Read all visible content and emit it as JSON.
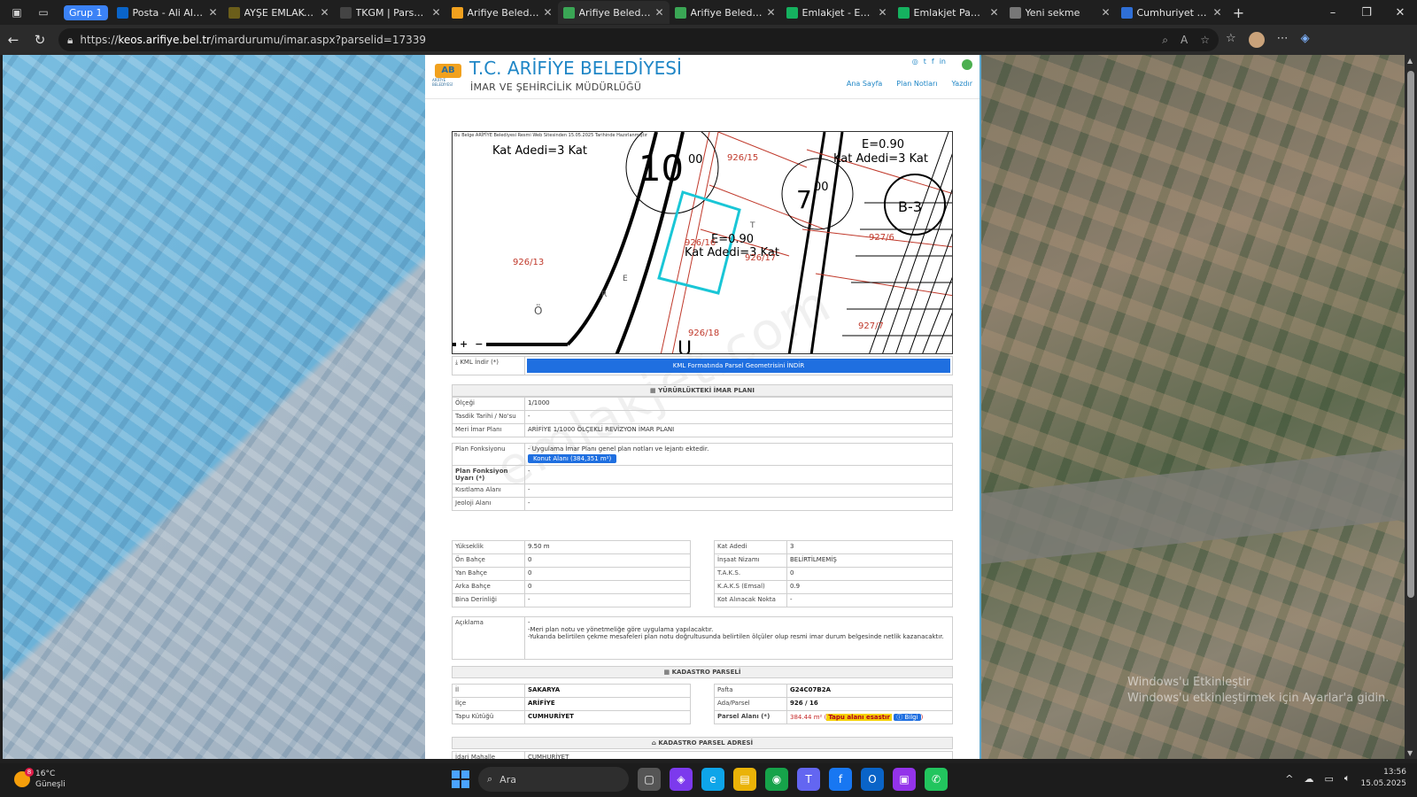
{
  "browser": {
    "group_label": "Grup 1",
    "tabs": [
      {
        "title": "Posta - Ali Altun -",
        "icon": "outlook-icon",
        "color": "#0a64c8"
      },
      {
        "title": "AYŞE EMLAKTAN",
        "icon": "s-icon",
        "color": "#6b5e1a"
      },
      {
        "title": "TKGM | Parsel Sor",
        "icon": "pin-icon",
        "color": "#444444"
      },
      {
        "title": "Arifiye Belediyesi",
        "icon": "arifiye-icon",
        "color": "#f1a11e"
      },
      {
        "title": "Arifiye Belediyesi",
        "icon": "compass-icon",
        "color": "#3aa655",
        "active": true
      },
      {
        "title": "Arifiye Belediyesi",
        "icon": "compass-icon",
        "color": "#3aa655"
      },
      {
        "title": "Emlakjet - Ev ve D",
        "icon": "emlakjet-icon",
        "color": "#15b15f"
      },
      {
        "title": "Emlakjet Panel",
        "icon": "emlakjet-icon",
        "color": "#15b15f"
      },
      {
        "title": "Yeni sekme",
        "icon": "page-icon",
        "color": "#777777"
      },
      {
        "title": "Cumhuriyet Mah",
        "icon": "globe-icon",
        "color": "#2f6fd6"
      }
    ],
    "url_prefix": "https://",
    "url_host": "keos.arifiye.bel.tr",
    "url_path": "/imardurumu/imar.aspx?parselid=17339"
  },
  "header": {
    "title": "T.C. ARİFİYE BELEDİYESİ",
    "subtitle": "İMAR VE ŞEHİRCİLİK MÜDÜRLÜĞÜ",
    "logo_text": "AB",
    "logo_small": "ARİFİYE BELEDİYESİ",
    "nav": [
      "Ana Sayfa",
      "Plan Notları",
      "Yazdır"
    ]
  },
  "map": {
    "notice": "Bu Belge ARİFİYE Belediyesi Resmi Web Sitesinden 15.05.2025 Tarihinde Hazırlanmıştır",
    "labels": {
      "kat_top_left": "Kat Adedi=3 Kat",
      "e_top_right": "E=0.90",
      "kat_top_right": "Kat Adedi=3 Kat",
      "e_center": "E=0.90",
      "kat_center": "Kat Adedi=3 Kat",
      "p1": "926/15",
      "p2": "926/16",
      "p3": "926/17",
      "p4": "926/13",
      "p5": "926/18",
      "p6": "927/6",
      "p7": "927/7",
      "circle1": "10",
      "circle1_sub": "00",
      "circle2": "7",
      "circle2_sub": "00",
      "b3": "B-3",
      "road_o": "Ö",
      "road_r": "R",
      "road_t": "T",
      "road_e": "E",
      "u_label": "U"
    },
    "zoom_in": "+",
    "zoom_out": "−"
  },
  "watermark": "emlakjet.com",
  "kml": {
    "label": "KML İndir (*)",
    "button": "KML Formatında Parsel Geometrisini İNDİR"
  },
  "imar_plani": {
    "section_title": "YÜRÜRLÜKTEKİ İMAR PLANI",
    "rows": [
      {
        "label": "Ölçeği",
        "value": "1/1000"
      },
      {
        "label": "Tasdik Tarihi / No'su",
        "value": "-"
      },
      {
        "label": "Meri İmar Planı",
        "value": "ARİFİYE 1/1000 ÖLÇEKLİ REVİZYON İMAR PLANI"
      }
    ],
    "fonksiyon_label": "Plan Fonksiyonu",
    "fonksiyon_text": "- Uygulama İmar Planı genel plan notları ve lejantı ektedir.",
    "fonksiyon_chip": "Konut Alanı (384,351 m²)",
    "uyari_label": "Plan Fonksiyon Uyarı (*)",
    "uyari_value": "-",
    "kisit_label": "Kısıtlama Alanı",
    "kisit_value": "-",
    "jeoloji_label": "Jeoloji Alanı",
    "jeoloji_value": "-"
  },
  "yapilasma_left": [
    {
      "label": "Yükseklik",
      "value": "9.50 m"
    },
    {
      "label": "Ön Bahçe",
      "value": "0"
    },
    {
      "label": "Yan Bahçe",
      "value": "0"
    },
    {
      "label": "Arka Bahçe",
      "value": "0"
    },
    {
      "label": "Bina Derinliği",
      "value": "-"
    }
  ],
  "yapilasma_right": [
    {
      "label": "Kat Adedi",
      "value": "3"
    },
    {
      "label": "İnşaat Nizamı",
      "value": "BELİRTİLMEMİŞ"
    },
    {
      "label": "T.A.K.S.",
      "value": "0"
    },
    {
      "label": "K.A.K.S (Emsal)",
      "value": "0.9"
    },
    {
      "label": "Kot Alınacak Nokta",
      "value": "-"
    }
  ],
  "aciklama": {
    "label": "Açıklama",
    "lines": [
      "-",
      "-Meri plan notu ve yönetmeliğe göre uygulama yapılacaktır.",
      "-Yukarıda belirtilen çekme mesafeleri plan notu doğrultusunda belirtilen ölçüler olup resmi imar durum belgesinde netlik kazanacaktır."
    ]
  },
  "kadastro": {
    "section_title": "KADASTRO PARSELİ",
    "left": [
      {
        "label": "İl",
        "value": "SAKARYA"
      },
      {
        "label": "İlçe",
        "value": "ARİFİYE"
      },
      {
        "label": "Tapu Kütüğü",
        "value": "CUMHURİYET"
      }
    ],
    "right": [
      {
        "label": "Pafta",
        "value": "G24C07B2A"
      },
      {
        "label": "Ada/Parsel",
        "value": "926 / 16"
      }
    ],
    "parsel_alani_label": "Parsel Alanı (*)",
    "parsel_alani_value": "384.44 m²",
    "tapu_esas": "Tapu alanı esastır",
    "bilgi": "Bilgi"
  },
  "adres": {
    "section_title": "KADASTRO PARSEL ADRESİ",
    "rows": [
      {
        "label": "İdari Mahalle",
        "value": "CUMHURİYET"
      }
    ]
  },
  "overlay": {
    "activate_line1": "Windows'u Etkinleştir",
    "activate_line2": "Windows'u etkinleştirmek için Ayarlar'a gidin."
  },
  "taskbar": {
    "temp": "16°C",
    "weather": "Güneşli",
    "weather_badge": "8",
    "search_placeholder": "Ara",
    "time": "13:56",
    "date": "15.05.2025"
  }
}
